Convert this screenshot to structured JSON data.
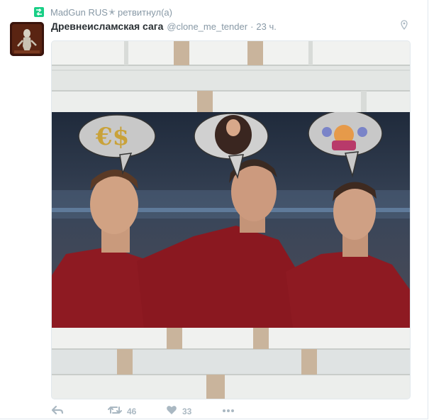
{
  "retweet": {
    "user": "MadGun RUS",
    "star": "✭",
    "action": "ретвитнул(а)"
  },
  "tweet": {
    "fullname": "Древнеисламская сага",
    "username": "@clone_me_tender",
    "separator": "·",
    "time": "23 ч."
  },
  "actions": {
    "retweet_count": "46",
    "like_count": "33"
  },
  "icons": {
    "retweet_context": "retweet-icon",
    "location": "location-pin-icon",
    "reply": "reply-icon",
    "retweet": "retweet-icon",
    "like": "heart-icon",
    "more": "more-dots-icon"
  },
  "colors": {
    "retweet_green": "#19cf86",
    "muted_text": "#8899a6",
    "action_icon": "#aab8c2"
  }
}
